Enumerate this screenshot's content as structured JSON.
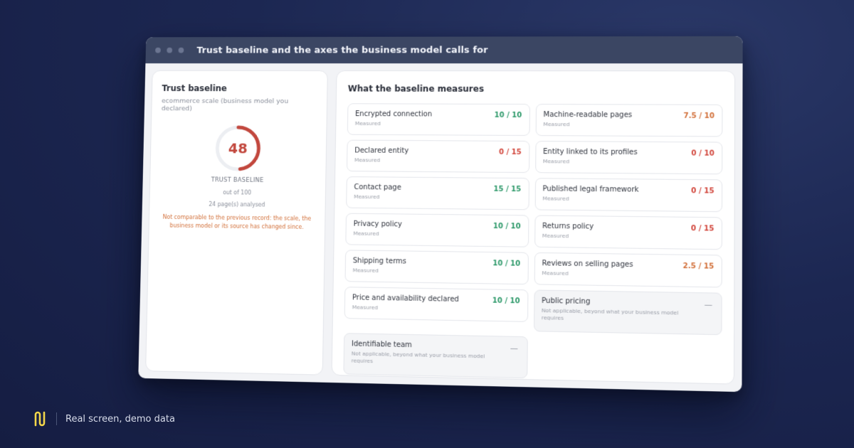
{
  "window": {
    "title": "Trust baseline and the axes the business model calls for"
  },
  "left": {
    "heading": "Trust baseline",
    "subtitle": "ecommerce scale (business model you declared)",
    "score": "48",
    "score_fraction": 0.48,
    "gauge_label": "TRUST BASELINE",
    "out_of": "out of 100",
    "pages": "24 page(s) analysed",
    "warning": "Not comparable to the previous record: the scale, the business model or its source has changed since."
  },
  "right": {
    "heading": "What the baseline measures",
    "items": [
      {
        "name": "Encrypted connection",
        "state": "Measured",
        "score": "10 / 10",
        "level": "good"
      },
      {
        "name": "Machine-readable pages",
        "state": "Measured",
        "score": "7.5 / 10",
        "level": "mid"
      },
      {
        "name": "Declared entity",
        "state": "Measured",
        "score": "0 / 15",
        "level": "bad"
      },
      {
        "name": "Entity linked to its profiles",
        "state": "Measured",
        "score": "0 / 10",
        "level": "bad"
      },
      {
        "name": "Contact page",
        "state": "Measured",
        "score": "15 / 15",
        "level": "good"
      },
      {
        "name": "Published legal framework",
        "state": "Measured",
        "score": "0 / 15",
        "level": "bad"
      },
      {
        "name": "Privacy policy",
        "state": "Measured",
        "score": "10 / 10",
        "level": "good"
      },
      {
        "name": "Returns policy",
        "state": "Measured",
        "score": "0 / 15",
        "level": "bad"
      },
      {
        "name": "Shipping terms",
        "state": "Measured",
        "score": "10 / 10",
        "level": "good"
      },
      {
        "name": "Reviews on selling pages",
        "state": "Measured",
        "score": "2.5 / 15",
        "level": "mid"
      },
      {
        "name": "Price and availability declared",
        "state": "Measured",
        "score": "10 / 10",
        "level": "good"
      },
      {
        "name": "Public pricing",
        "state": "Not applicable, beyond what your business model requires",
        "score": "—",
        "level": "na"
      },
      {
        "name": "Identifiable team",
        "state": "Not applicable, beyond what your business model requires",
        "score": "—",
        "level": "na"
      }
    ]
  },
  "colors": {
    "good": "#2f9a6b",
    "bad": "#d2473d",
    "mid": "#d2703a",
    "gauge": "#c2473d"
  },
  "footer": {
    "text": "Real screen, demo data",
    "logo_icon": "brand-logo-icon"
  }
}
